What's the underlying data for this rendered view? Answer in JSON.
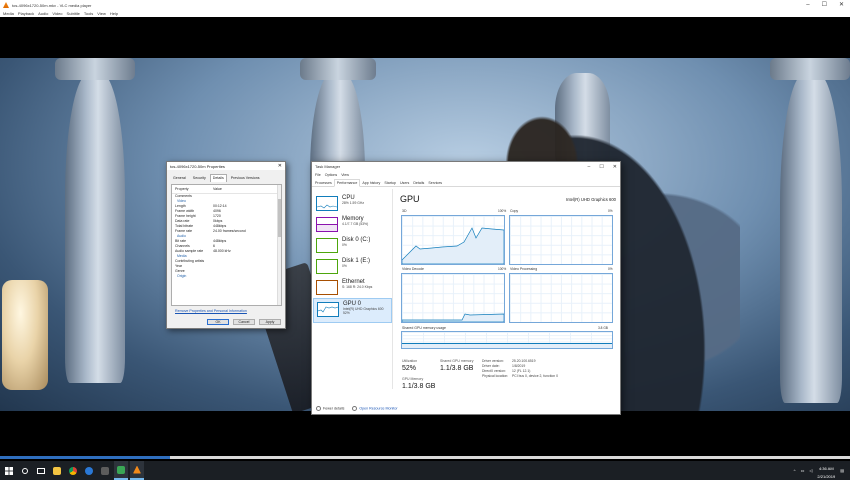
{
  "vlc": {
    "title": "tos-4096x1720-50m.mkv - VLC media player",
    "menu": [
      "Media",
      "Playback",
      "Audio",
      "Video",
      "Subtitle",
      "Tools",
      "View",
      "Help"
    ],
    "seek_fraction": 0.2
  },
  "properties": {
    "title": "tos-4096x1720-50m Properties",
    "tabs": [
      "General",
      "Security",
      "Details",
      "Previous Versions"
    ],
    "active_tab": "Details",
    "col_property": "Property",
    "col_value": "Value",
    "rows": [
      {
        "k": "Comments",
        "v": ""
      },
      {
        "k": "Video",
        "v": "",
        "section": true
      },
      {
        "k": "Length",
        "v": "00:12:14"
      },
      {
        "k": "Frame width",
        "v": "4096"
      },
      {
        "k": "Frame height",
        "v": "1720"
      },
      {
        "k": "Data rate",
        "v": "0kbps"
      },
      {
        "k": "Total bitrate",
        "v": "448kbps"
      },
      {
        "k": "Frame rate",
        "v": "24.00 frames/second"
      },
      {
        "k": "Audio",
        "v": "",
        "section": true
      },
      {
        "k": "Bit rate",
        "v": "448kbps"
      },
      {
        "k": "Channels",
        "v": "6"
      },
      {
        "k": "Audio sample rate",
        "v": "48.000 kHz"
      },
      {
        "k": "Media",
        "v": "",
        "section": true
      },
      {
        "k": "Contributing artists",
        "v": ""
      },
      {
        "k": "Year",
        "v": ""
      },
      {
        "k": "Genre",
        "v": ""
      },
      {
        "k": "Origin",
        "v": "",
        "section": true
      }
    ],
    "link": "Remove Properties and Personal Information",
    "ok": "OK",
    "cancel": "Cancel",
    "apply": "Apply"
  },
  "taskmgr": {
    "title": "Task Manager",
    "menu": [
      "File",
      "Options",
      "View"
    ],
    "tabs": [
      "Processes",
      "Performance",
      "App history",
      "Startup",
      "Users",
      "Details",
      "Services"
    ],
    "active_tab": "Performance",
    "resources": [
      {
        "name": "CPU",
        "sub": "28%  1.59 GHz",
        "color": "#117dbb"
      },
      {
        "name": "Memory",
        "sub": "4.1/7.7 GB (53%)",
        "color": "#8b12ae"
      },
      {
        "name": "Disk 0 (C:)",
        "sub": "0%",
        "color": "#4da60c"
      },
      {
        "name": "Disk 1 (E:)",
        "sub": "0%",
        "color": "#4da60c"
      },
      {
        "name": "Ethernet",
        "sub": "S: 168  R: 24.0 Kbps",
        "color": "#a74f01"
      },
      {
        "name": "GPU 0",
        "sub": "Intel(R) UHD Graphics 600",
        "sub2": "52%",
        "color": "#117dbb"
      }
    ],
    "gpu": {
      "title": "GPU",
      "adapter": "Intel(R) UHD Graphics 600",
      "engines": [
        {
          "name": "3D",
          "pct": "100%"
        },
        {
          "name": "Copy",
          "pct": "0%"
        },
        {
          "name": "Video Decode",
          "pct": "100%"
        },
        {
          "name": "Video Processing",
          "pct": "0%"
        }
      ],
      "shared_label": "Shared GPU memory usage",
      "shared_max": "3.8 GB",
      "utilization_label": "Utilization",
      "utilization": "52%",
      "shared_mem_label": "Shared GPU memory",
      "shared_mem": "1.1/3.8 GB",
      "gpu_mem_label": "GPU Memory",
      "gpu_mem": "1.1/3.8 GB",
      "details": [
        {
          "k": "Driver version:",
          "v": "25.20.100.6519"
        },
        {
          "k": "Driver date:",
          "v": "1/8/2019"
        },
        {
          "k": "DirectX version:",
          "v": "12 (FL 12.1)"
        },
        {
          "k": "Physical location:",
          "v": "PCI bus 0, device 2, function 0"
        }
      ]
    },
    "fewer": "Fewer details",
    "resmon": "Open Resource Monitor"
  },
  "taskbar": {
    "time": "4:36 AM",
    "date": "2/21/2019"
  }
}
